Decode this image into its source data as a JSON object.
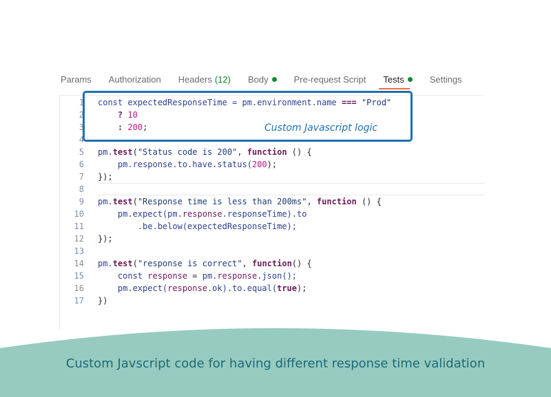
{
  "tabs": [
    {
      "label": "Params"
    },
    {
      "label": "Authorization"
    },
    {
      "label": "Headers",
      "count": "(12)"
    },
    {
      "label": "Body"
    },
    {
      "label": "Pre-request Script"
    },
    {
      "label": "Tests"
    },
    {
      "label": "Settings"
    }
  ],
  "active_tab": "Tests",
  "line_numbers": [
    "1",
    "2",
    "3",
    "4",
    "5",
    "6",
    "7",
    "8",
    "9",
    "10",
    "11",
    "12",
    "13",
    "14",
    "15",
    "16",
    "17"
  ],
  "code": {
    "l1": {
      "a": "const expectedResponseTime = pm.environment.name ",
      "b": "===",
      "c": " ",
      "d": "\"Prod\""
    },
    "l2": {
      "a": "    ",
      "b": "?",
      "c": " ",
      "d": "10"
    },
    "l3": {
      "a": "    ",
      "b": ":",
      "c": " ",
      "d": "200",
      "e": ";"
    },
    "l5": {
      "a": "pm.",
      "b": "test",
      "c": "(",
      "d": "\"Status code is 200\"",
      "e": ", ",
      "f": "function",
      "g": " () {"
    },
    "l6": {
      "a": "    pm.response.to.have.status(",
      "b": "200",
      "c": ");"
    },
    "l7": {
      "a": "});"
    },
    "l9": {
      "a": "pm.",
      "b": "test",
      "c": "(",
      "d": "\"Response time is less than 200ms\"",
      "e": ", ",
      "f": "function",
      "g": " () {"
    },
    "l10": {
      "a": "    pm.expect(pm.",
      "b": "response",
      "c": ".responseTime).to"
    },
    "l11": {
      "a": "        .be.below(expectedResponseTime);"
    },
    "l12": {
      "a": "});"
    },
    "l14": {
      "a": "pm.",
      "b": "test",
      "c": "(",
      "d": "\"response is correct\"",
      "e": ", ",
      "f": "function",
      "g": "() {"
    },
    "l15": {
      "a": "    const ",
      "b": "response",
      "c": " = ",
      "d": "pm.",
      "e": "response",
      "f": ".json();"
    },
    "l16": {
      "a": "    pm.expect(",
      "b": "response",
      "c": ".ok).to.equal(",
      "d": "true",
      "e": ");"
    },
    "l17": {
      "a": "})"
    }
  },
  "annotation": "Custom Javascript logic",
  "caption": "Custom Javscript code for having different response time validation",
  "colors": {
    "accent": "#f26b3a",
    "status_dot": "#0f8a3a",
    "highlight": "#1f6fb2",
    "banner": "#97cbc0",
    "caption": "#1d6a77"
  }
}
